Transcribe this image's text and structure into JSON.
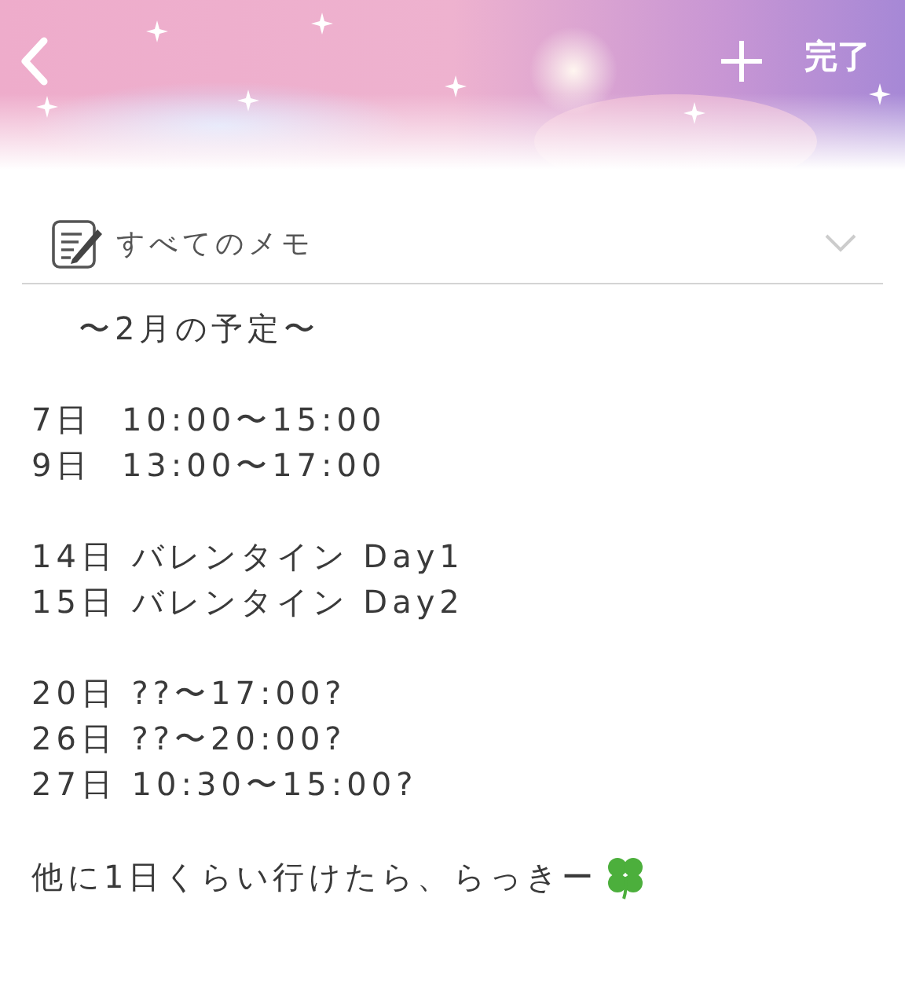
{
  "header": {
    "done": "完了"
  },
  "folder": {
    "label": "すべてのメモ"
  },
  "memo": {
    "title": "〜2月の予定〜",
    "groups": [
      [
        "7日  10:00〜15:00",
        "9日  13:00〜17:00"
      ],
      [
        "14日 バレンタイン Day1",
        "15日 バレンタイン Day2"
      ],
      [
        "20日 ??〜17:00?",
        "26日 ??〜20:00?",
        "27日 10:30〜15:00?"
      ]
    ],
    "closing": "他に1日くらい行けたら、らっきー"
  }
}
